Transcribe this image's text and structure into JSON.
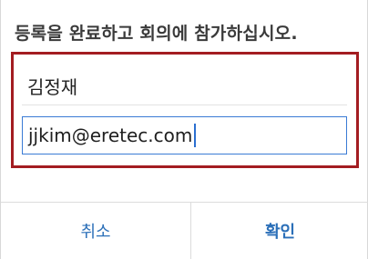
{
  "dialog": {
    "title": "등록을 완료하고 회의에 참가하십시오.",
    "name_value": "김정재",
    "email_value": "jjkim@eretec.com",
    "cancel_label": "취소",
    "ok_label": "확인"
  },
  "colors": {
    "highlight": "#a31c21",
    "accent": "#2b6fb8",
    "focus_border": "#3a7bd5"
  }
}
